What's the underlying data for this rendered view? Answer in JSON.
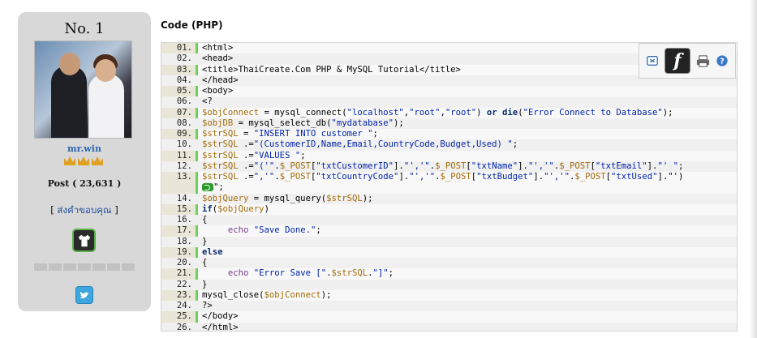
{
  "profile": {
    "rank": "No. 1",
    "username": "mr.win",
    "posts": "Post ( 23,631 )",
    "thanks_link": "ส่งคำขอบคุณ",
    "crown_count": 3,
    "colors": {
      "card_bg": "#d8d8d8",
      "username": "#2a66b2",
      "crown": "#e0a020",
      "twitter": "#3fa7df"
    },
    "icons": [
      "avatar",
      "crown-icon",
      "shirt-badge-icon",
      "twitter-icon"
    ]
  },
  "code": {
    "title": "Code (PHP)",
    "toolbar_icons": [
      "view-source-icon",
      "flash-icon",
      "print-icon",
      "help-icon"
    ],
    "lines": [
      {
        "no": "01.",
        "text": "<html>"
      },
      {
        "no": "02.",
        "text": "<head>"
      },
      {
        "no": "03.",
        "text": "<title>ThaiCreate.Com PHP & MySQL Tutorial</title>"
      },
      {
        "no": "04.",
        "text": "</head>"
      },
      {
        "no": "05.",
        "text": "<body>"
      },
      {
        "no": "06.",
        "text": "<?"
      },
      {
        "no": "07.",
        "text": "$objConnect = mysql_connect(\"localhost\",\"root\",\"root\") or die(\"Error Connect to Database\");"
      },
      {
        "no": "08.",
        "text": "$objDB = mysql_select_db(\"mydatabase\");"
      },
      {
        "no": "09.",
        "text": "$strSQL = \"INSERT INTO customer \";"
      },
      {
        "no": "10.",
        "text": "$strSQL .=\"(CustomerID,Name,Email,CountryCode,Budget,Used) \";"
      },
      {
        "no": "11.",
        "text": "$strSQL .=\"VALUES \";"
      },
      {
        "no": "12.",
        "text": "$strSQL .=\"('\".$_POST[\"txtCustomerID\"].\"','\".$_POST[\"txtName\"].\"','\".$_POST[\"txtEmail\"].\"' \";"
      },
      {
        "no": "13.",
        "text": "$strSQL .=\",'\".$_POST[\"txtCountryCode\"].\"','\".$_POST[\"txtBudget\"].\"','\".$_POST[\"txtUsed\"].\"')",
        "wrap": "\";"
      },
      {
        "no": "14.",
        "text": "$objQuery = mysql_query($strSQL);"
      },
      {
        "no": "15.",
        "text": "if($objQuery)"
      },
      {
        "no": "16.",
        "text": "{"
      },
      {
        "no": "17.",
        "text": "     echo \"Save Done.\";"
      },
      {
        "no": "18.",
        "text": "}"
      },
      {
        "no": "19.",
        "text": "else"
      },
      {
        "no": "20.",
        "text": "{"
      },
      {
        "no": "21.",
        "text": "     echo \"Error Save [\".$strSQL.\"]\";"
      },
      {
        "no": "22.",
        "text": "}"
      },
      {
        "no": "23.",
        "text": "mysql_close($objConnect);"
      },
      {
        "no": "24.",
        "text": "?>"
      },
      {
        "no": "25.",
        "text": "</body>"
      },
      {
        "no": "26.",
        "text": "</html>"
      }
    ],
    "colors": {
      "gutter": "#e9e6d7",
      "gutter_line": "#6cd05a",
      "variable": "#a36b09",
      "string": "#0022aa",
      "keyword": "#0a2c6e"
    }
  }
}
